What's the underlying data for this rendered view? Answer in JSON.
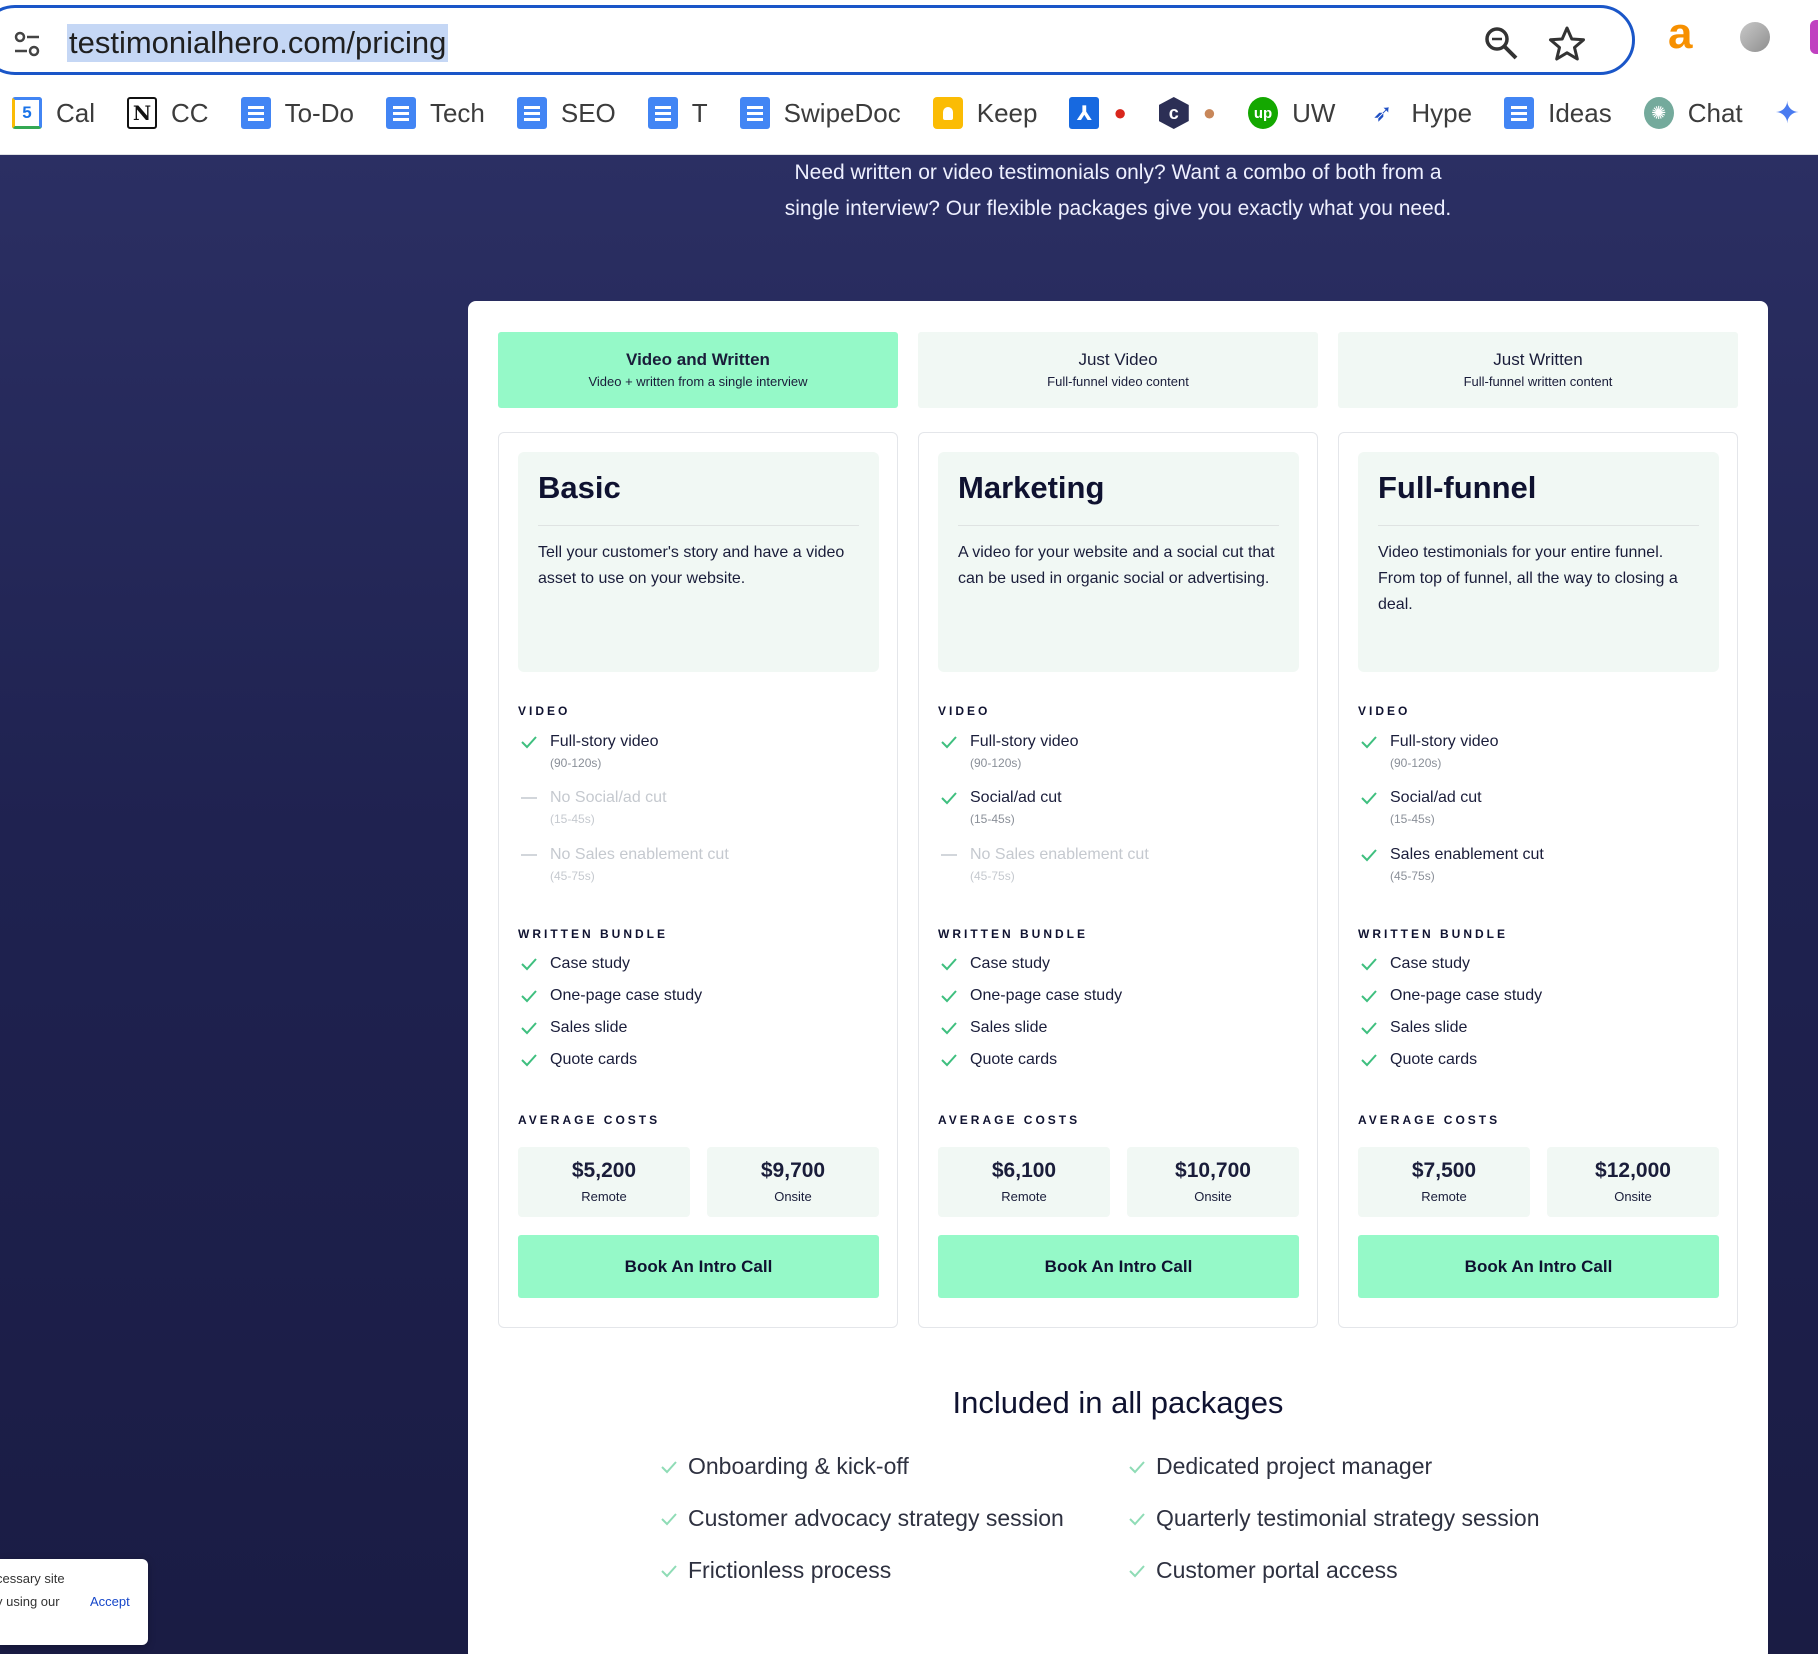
{
  "browser": {
    "url": "testimonialhero.com/pricing",
    "bookmarks": [
      {
        "label": "Cal",
        "icon": "calendar-icon"
      },
      {
        "label": "CC",
        "icon": "notion-icon"
      },
      {
        "label": "To-Do",
        "icon": "doc-icon"
      },
      {
        "label": "Tech",
        "icon": "doc-icon"
      },
      {
        "label": "SEO",
        "icon": "doc-icon"
      },
      {
        "label": "T",
        "icon": "doc-icon"
      },
      {
        "label": "SwipeDoc",
        "icon": "doc-icon"
      },
      {
        "label": "Keep",
        "icon": "keep-icon"
      },
      {
        "label": "",
        "icon": "app-icon"
      },
      {
        "label": "",
        "icon": "hexagon-icon"
      },
      {
        "label": "UW",
        "icon": "upwork-icon"
      },
      {
        "label": "Hype",
        "icon": "bird-icon"
      },
      {
        "label": "Ideas",
        "icon": "doc-icon"
      },
      {
        "label": "Chat",
        "icon": "chatgpt-icon"
      }
    ],
    "calendar_day": "5",
    "extension_a": "a"
  },
  "intro": {
    "line1": "Need written or video testimonials only? Want a combo of both from a",
    "line2": "single interview? Our flexible packages give you exactly what you need."
  },
  "tabs": [
    {
      "title": "Video and Written",
      "subtitle": "Video + written from a single interview",
      "active": true
    },
    {
      "title": "Just Video",
      "subtitle": "Full-funnel video content",
      "active": false
    },
    {
      "title": "Just Written",
      "subtitle": "Full-funnel written content",
      "active": false
    }
  ],
  "labels": {
    "video": "VIDEO",
    "written": "WRITTEN BUNDLE",
    "costs": "AVERAGE COSTS",
    "remote": "Remote",
    "onsite": "Onsite",
    "cta": "Book An Intro Call"
  },
  "plans": [
    {
      "name": "Basic",
      "description": "Tell your customer's story and have a video asset to use on your website.",
      "video": [
        {
          "text": "Full-story video",
          "duration": "(90-120s)",
          "included": true
        },
        {
          "text": "No Social/ad cut",
          "duration": "(15-45s)",
          "included": false
        },
        {
          "text": "No Sales enablement cut",
          "duration": "(45-75s)",
          "included": false
        }
      ],
      "written": [
        "Case study",
        "One-page case study",
        "Sales slide",
        "Quote cards"
      ],
      "remote_cost": "$5,200",
      "onsite_cost": "$9,700"
    },
    {
      "name": "Marketing",
      "description": "A video for your website and a social cut that can be used in organic social or advertising.",
      "video": [
        {
          "text": "Full-story video",
          "duration": "(90-120s)",
          "included": true
        },
        {
          "text": "Social/ad cut",
          "duration": "(15-45s)",
          "included": true
        },
        {
          "text": "No Sales enablement cut",
          "duration": "(45-75s)",
          "included": false
        }
      ],
      "written": [
        "Case study",
        "One-page case study",
        "Sales slide",
        "Quote cards"
      ],
      "remote_cost": "$6,100",
      "onsite_cost": "$10,700"
    },
    {
      "name": "Full-funnel",
      "description": "Video testimonials for your entire funnel. From top of funnel, all the way to closing a deal.",
      "video": [
        {
          "text": "Full-story video",
          "duration": "(90-120s)",
          "included": true
        },
        {
          "text": "Social/ad cut",
          "duration": "(15-45s)",
          "included": true
        },
        {
          "text": "Sales enablement cut",
          "duration": "(45-75s)",
          "included": true
        }
      ],
      "written": [
        "Case study",
        "One-page case study",
        "Sales slide",
        "Quote cards"
      ],
      "remote_cost": "$7,500",
      "onsite_cost": "$12,000"
    }
  ],
  "included": {
    "title": "Included in all packages",
    "items": [
      "Onboarding & kick-off",
      "Dedicated project manager",
      "Customer advocacy strategy session",
      "Quarterly testimonial strategy session",
      "Frictionless process",
      "Customer portal access"
    ]
  },
  "cookie": {
    "line1": "cessary site",
    "line2": "y using our",
    "accept": "Accept"
  },
  "colors": {
    "accent": "#95f9c8",
    "check": "#3fbf7f",
    "page_bg": "#1f2250",
    "address_focus": "#1a56c8"
  }
}
